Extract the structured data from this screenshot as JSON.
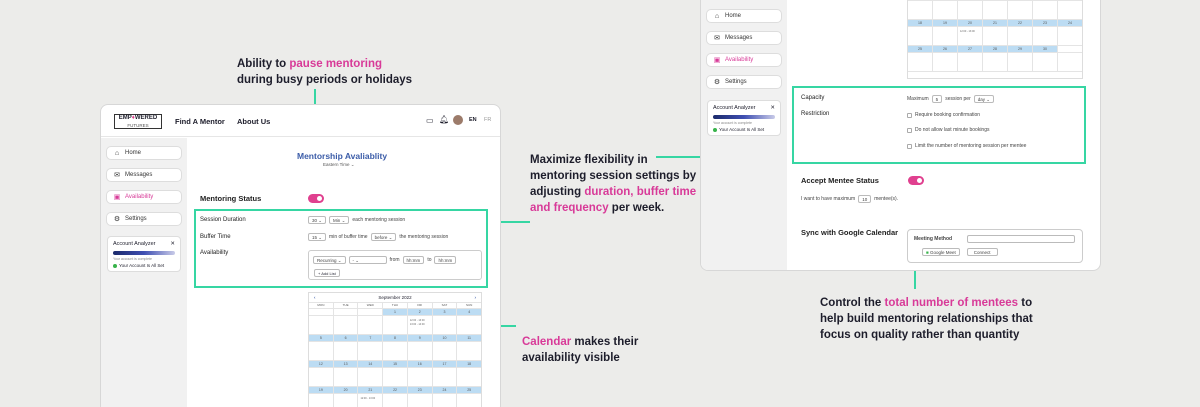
{
  "annotations": {
    "pause": {
      "pre": "Ability to ",
      "hl": "pause mentoring",
      "post": "during busy periods or holidays"
    },
    "flex": {
      "l1": "Maximize flexibility in",
      "l2": "mentoring session settings by",
      "l3pre": "adjusting ",
      "l3hl": "duration, buffer time",
      "l4hl": "and frequency",
      "l4post": " per week."
    },
    "calendar": {
      "hl": "Calendar",
      "post": " makes their",
      "l2": "availability visible"
    },
    "mentees": {
      "pre": "Control the ",
      "hl": "total number of mentees",
      "post": " to",
      "l2": "help build mentoring relationships that",
      "l3": "focus on quality rather than quantity"
    }
  },
  "colors": {
    "accent": "#36d6a3",
    "highlight": "#d83a98",
    "toggle": "#e0408f",
    "brand_blue": "#1b2a6b"
  },
  "left": {
    "logo": {
      "a": "EMP",
      "b": "WERED",
      "c": "FUTURES"
    },
    "nav": [
      "Find A Mentor",
      "About Us"
    ],
    "lang": [
      "EN",
      "FR"
    ],
    "sidebar": [
      {
        "icon": "home-icon",
        "label": "Home"
      },
      {
        "icon": "mail-icon",
        "label": "Messages"
      },
      {
        "icon": "calendar-icon",
        "label": "Availability"
      },
      {
        "icon": "gear-icon",
        "label": "Settings"
      }
    ],
    "analyzer": {
      "title": "Account Analyzer",
      "sub": "Your account is complete",
      "status": "Your Account Is All Set"
    },
    "title": "Mentorship Avaliablity",
    "timezone": "Eastern Time",
    "mentoring_status": "Mentoring Status",
    "session_duration": {
      "label": "Session Duration",
      "value": "30",
      "unit": "Min",
      "suffix": "each mentoring session"
    },
    "buffer": {
      "label": "Buffer Time",
      "value": "15",
      "mid": "min of buffer time",
      "when": "before",
      "suffix": "the mentoring session"
    },
    "availability": {
      "label": "Availability",
      "repeat": "Recurring",
      "day": "-",
      "from": "from",
      "start": "hh:mm",
      "to": "to",
      "end": "hh:mm",
      "add": "+ Add List"
    },
    "calendar": {
      "month": "September 2022",
      "days": [
        "MON",
        "TUE",
        "WED",
        "THU",
        "FRI",
        "SAT",
        "SUN"
      ],
      "weeks": [
        [
          "",
          "",
          "",
          "1",
          "2",
          "3",
          "4"
        ],
        [
          "5",
          "6",
          "7",
          "8",
          "9",
          "10",
          "11"
        ],
        [
          "12",
          "13",
          "14",
          "15",
          "16",
          "17",
          "18"
        ],
        [
          "19",
          "20",
          "21",
          "22",
          "23",
          "24",
          "25"
        ]
      ],
      "events": [
        "12:00 - 13:00",
        "13:00 - 14:00",
        "12:00 - 13:00"
      ]
    }
  },
  "right": {
    "sidebar": [
      {
        "icon": "home-icon",
        "label": "Home"
      },
      {
        "icon": "mail-icon",
        "label": "Messages"
      },
      {
        "icon": "calendar-icon",
        "label": "Availability"
      },
      {
        "icon": "gear-icon",
        "label": "Settings"
      }
    ],
    "analyzer": {
      "title": "Account Analyzer",
      "sub": "Your account is complete",
      "status": "Your Account Is All Set"
    },
    "calendar": {
      "weeks": [
        [
          "11",
          "12",
          "13",
          "14",
          "15",
          "16",
          "17"
        ],
        [
          "18",
          "19",
          "20",
          "21",
          "22",
          "23",
          "24"
        ],
        [
          "25",
          "26",
          "27",
          "28",
          "29",
          "30",
          ""
        ]
      ],
      "event": "12:00 - 13:00"
    },
    "capacity": {
      "label": "Capacity",
      "pre": "Maximum",
      "value": "5",
      "mid": "session per",
      "period": "day"
    },
    "restriction": {
      "label": "Restriction",
      "options": [
        "Require booking confirmation",
        "Do not allow last minute bookings",
        "Limit the number of mentoring session per mentee"
      ]
    },
    "accept": {
      "label": "Accept Mentee Status",
      "pre": "I want to have maximum",
      "value": "10",
      "post": "mentee(s)."
    },
    "sync": {
      "label": "Sync with Google Calendar",
      "method": "Meeting Method",
      "google": "Google Meet",
      "connect": "Connect"
    }
  }
}
